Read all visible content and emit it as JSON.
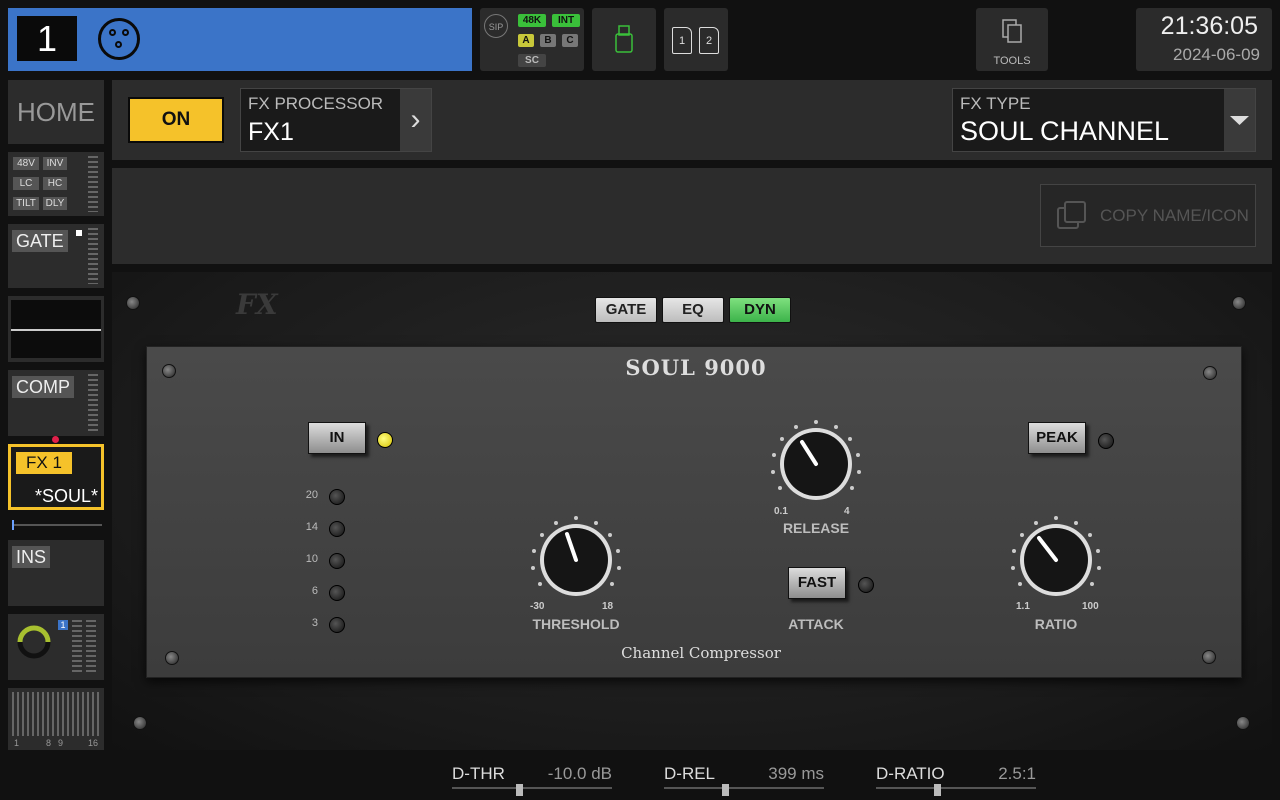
{
  "top": {
    "channel_number": "1",
    "sync": {
      "sip": "SIP",
      "rate": "48K",
      "clock": "INT",
      "a": "A",
      "b": "B",
      "c": "C",
      "sc": "SC"
    },
    "sd_slots": [
      "1",
      "2"
    ],
    "tools_label": "TOOLS",
    "time": "21:36:05",
    "date": "2024-06-09"
  },
  "sidebar": {
    "home": "HOME",
    "preamp_tags": [
      "48V",
      "INV",
      "LC",
      "HC",
      "TILT",
      "DLY"
    ],
    "gate": "GATE",
    "comp": "COMP",
    "fx_label": "FX 1",
    "fx_value": "*SOUL*",
    "ins": "INS",
    "pan_badge": "1",
    "bus_labels": [
      "1",
      "8",
      "9",
      "16"
    ]
  },
  "header": {
    "on_label": "ON",
    "fx_processor_label": "FX PROCESSOR",
    "fx_processor_value": "FX1",
    "fx_type_label": "FX TYPE",
    "fx_type_value": "SOUL CHANNEL",
    "copy_label": "COPY NAME/ICON"
  },
  "plugin": {
    "tabs": [
      "GATE",
      "EQ",
      "DYN"
    ],
    "active_tab": "DYN",
    "title": "SOUL 9000",
    "subtitle": "Channel Compressor",
    "in_label": "IN",
    "peak_label": "PEAK",
    "fast_label": "FAST",
    "gr_leds": [
      "20",
      "14",
      "10",
      "6",
      "3"
    ],
    "threshold": {
      "label": "THRESHOLD",
      "min": "-30",
      "max": "18"
    },
    "release": {
      "label": "RELEASE",
      "min": "0.1",
      "max": "4"
    },
    "attack": {
      "label": "ATTACK"
    },
    "ratio": {
      "label": "RATIO",
      "min": "1.1",
      "max": "100"
    },
    "colors": {
      "in_led": "#d5c000",
      "dyn_tab": "#3cb34a",
      "on_button": "#f5c22a",
      "channel_blue": "#3b74c8"
    }
  },
  "params": [
    {
      "name": "D-THR",
      "value": "-10.0 dB",
      "level": 0.4
    },
    {
      "name": "D-REL",
      "value": "399 ms",
      "level": 0.38
    },
    {
      "name": "D-RATIO",
      "value": "2.5:1",
      "level": 0.38
    }
  ]
}
